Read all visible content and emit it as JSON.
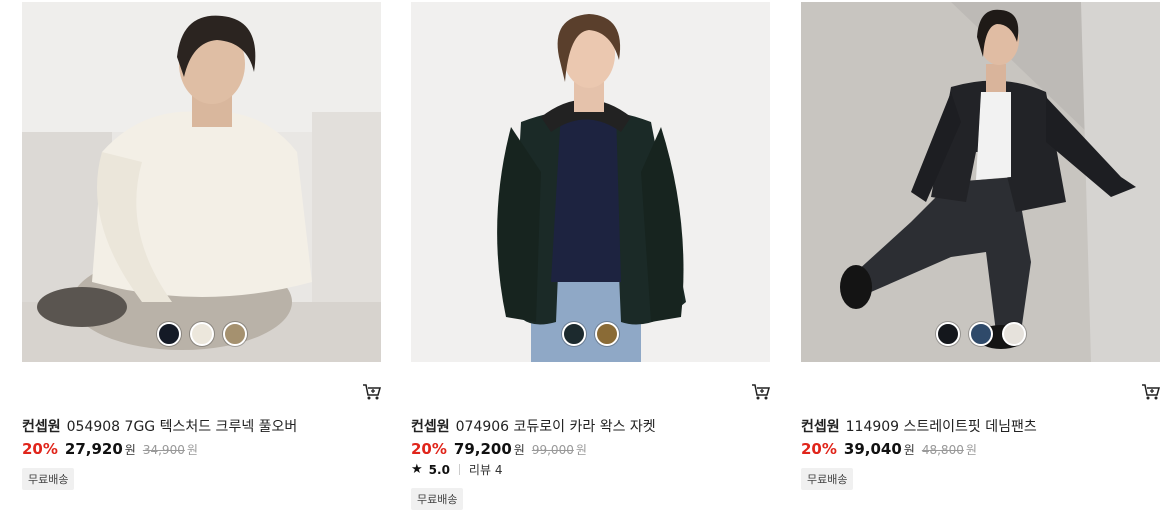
{
  "products": [
    {
      "brand": "컨셉원",
      "name": "054908 7GG 텍스처드 크루넥 풀오버",
      "discount": "20%",
      "price": "27,920",
      "currency": "원",
      "original_price": "34,900",
      "original_currency": "원",
      "badge": "무료배송",
      "swatches": [
        "#141a26",
        "#ece7dc",
        "#a5916f"
      ],
      "icon": "cart-icon"
    },
    {
      "brand": "컨셉원",
      "name": "074906 코듀로이 카라 왁스 자켓",
      "discount": "20%",
      "price": "79,200",
      "currency": "원",
      "original_price": "99,000",
      "original_currency": "원",
      "rating": "5.0",
      "review": "리뷰 4",
      "badge": "무료배송",
      "swatches": [
        "#1c2a2e",
        "#8a6b36"
      ],
      "icon": "cart-icon"
    },
    {
      "brand": "컨셉원",
      "name": "114909 스트레이트핏 데님팬츠",
      "discount": "20%",
      "price": "39,040",
      "currency": "원",
      "original_price": "48,800",
      "original_currency": "원",
      "badge": "무료배송",
      "swatches": [
        "#14171c",
        "#2f4a6a",
        "#e6e2dc"
      ],
      "icon": "cart-icon"
    }
  ]
}
